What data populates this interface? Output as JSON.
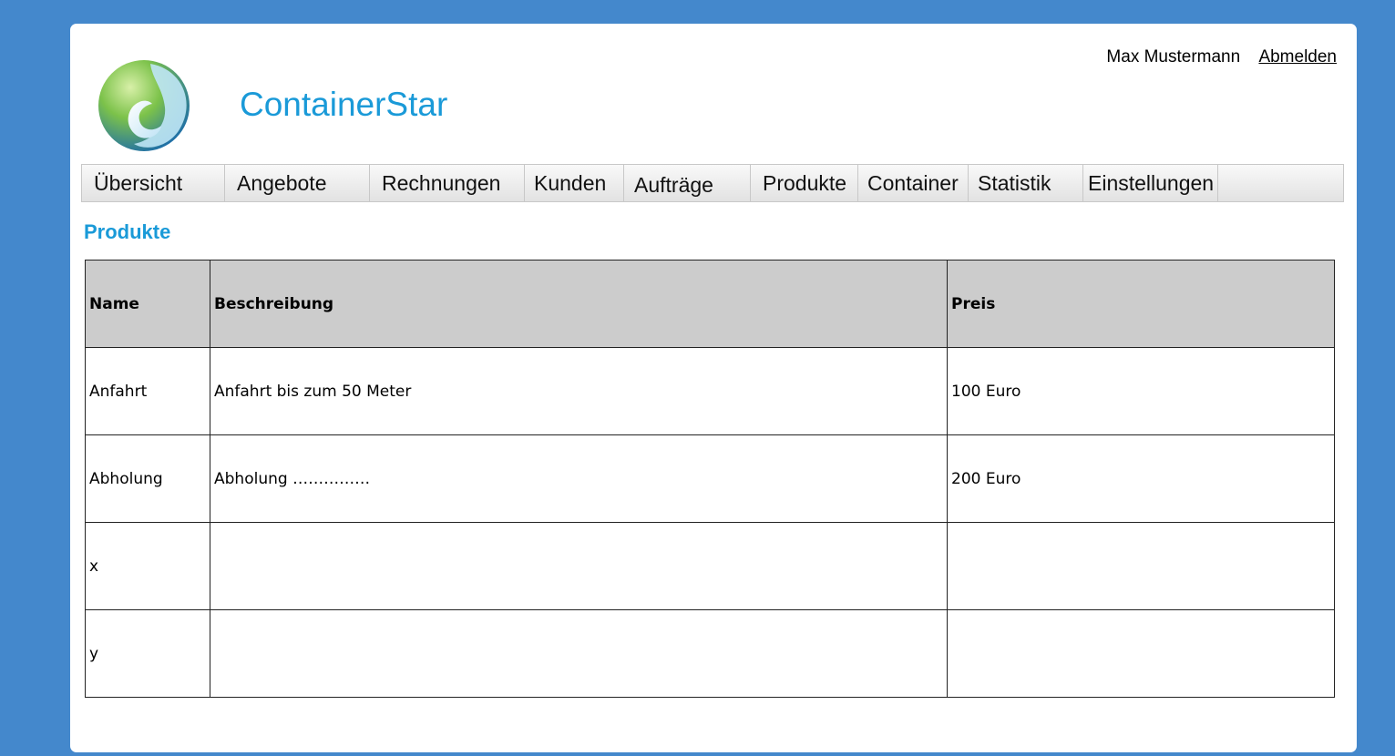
{
  "header": {
    "app_title": "ContainerStar",
    "user_name": "Max Mustermann",
    "logout_label": "Abmelden"
  },
  "nav": {
    "items": [
      "Übersicht",
      "Angebote",
      "Rechnungen",
      "Kunden",
      "Aufträge",
      "Produkte",
      "Container",
      "Statistik",
      "Einstellungen"
    ]
  },
  "main": {
    "section_title": "Produkte",
    "table": {
      "columns": [
        "Name",
        "Beschreibung",
        "Preis"
      ],
      "rows": [
        [
          "Anfahrt",
          "Anfahrt bis zum 50 Meter",
          "100 Euro"
        ],
        [
          "Abholung",
          "Abholung ……………",
          "200 Euro"
        ],
        [
          "x",
          "",
          ""
        ],
        [
          "y",
          "",
          ""
        ]
      ]
    }
  },
  "colors": {
    "background": "#4488cc",
    "brand": "#1a9ad8",
    "table_header_bg": "#cccccc"
  },
  "icons": {
    "logo": "containerstar-logo"
  }
}
